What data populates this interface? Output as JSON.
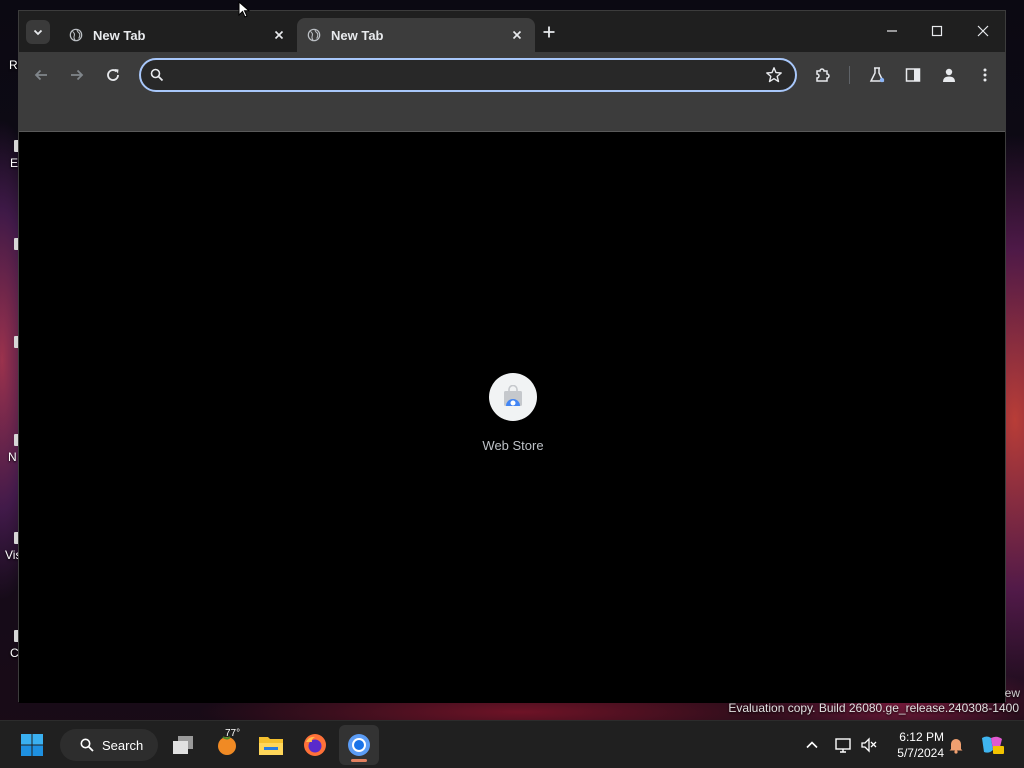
{
  "desktop": {
    "icons": [
      {
        "label": "R"
      },
      {
        "label": "E"
      },
      {
        "label": ""
      },
      {
        "label": ""
      },
      {
        "label": "N"
      },
      {
        "label": "Vis"
      },
      {
        "label": "C"
      }
    ],
    "watermark": "Evaluation copy. Build 26080.ge_release.240308-1400",
    "watermark_side": "ew"
  },
  "browser": {
    "tabs": [
      {
        "title": "New Tab",
        "favicon": "globe-icon",
        "active": false
      },
      {
        "title": "New Tab",
        "favicon": "globe-icon",
        "active": true
      }
    ],
    "omnibox": {
      "value": "",
      "placeholder": ""
    },
    "toolbar_icons": [
      "back-icon",
      "forward-icon",
      "reload-icon",
      "search-icon",
      "bookmark-star-icon",
      "extensions-icon",
      "labs-flask-icon",
      "side-panel-icon",
      "profile-icon",
      "menu-icon"
    ],
    "window_controls": [
      "minimize-icon",
      "maximize-icon",
      "close-icon"
    ],
    "shortcuts": [
      {
        "label": "Web Store",
        "icon": "web-store-icon"
      }
    ]
  },
  "taskbar": {
    "search_label": "Search",
    "weather_temp": "77°",
    "apps": [
      "windows-start-icon",
      "search-icon",
      "task-view-icon",
      "weather-icon",
      "file-explorer-icon",
      "firefox-icon",
      "chrome-icon"
    ],
    "tray_icons": [
      "chevron-up-icon",
      "network-icon",
      "volume-muted-icon",
      "notification-bell-icon",
      "copilot-icon"
    ],
    "clock": {
      "time": "6:12 PM",
      "date": "5/7/2024"
    }
  },
  "colors": {
    "accent": "#a8c7fa",
    "tab_active_bg": "#3c3c3c",
    "titlebar_bg": "#1f1f1f",
    "taskbar_bg": "#202020"
  }
}
